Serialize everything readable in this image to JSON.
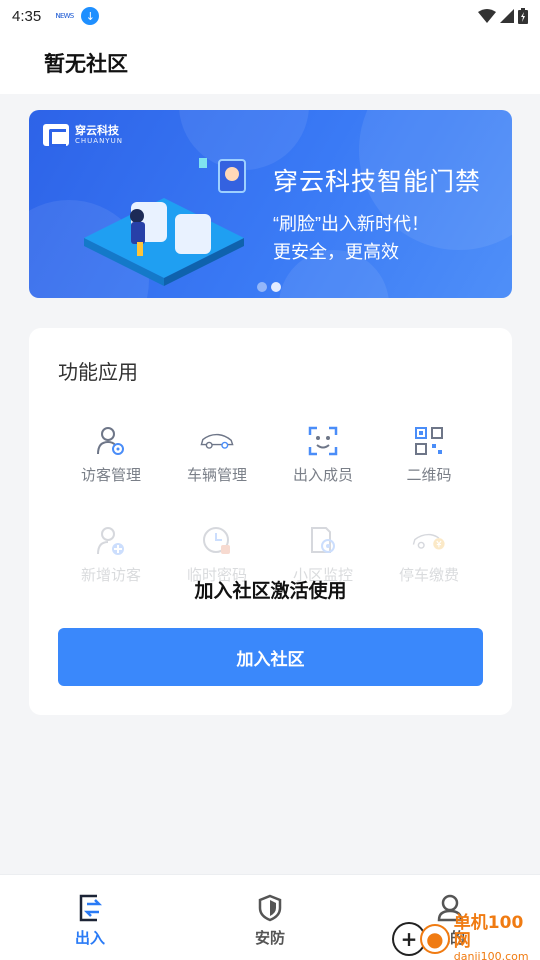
{
  "status_bar": {
    "time": "4:35",
    "small_icon": "ɴᴇᴡs",
    "download_icon": "download-icon",
    "wifi_icon": "wifi-icon",
    "signal_icon": "signal-icon",
    "battery_icon": "battery-icon"
  },
  "header": {
    "title": "暂无社区"
  },
  "banner": {
    "brand_cn": "穿云科技",
    "brand_en": "CHUANYUN",
    "title": "穿云科技智能门禁",
    "line1": "“刷脸”出入新时代！",
    "line2": "更安全，更高效",
    "pages": 2,
    "active_page": 2
  },
  "functions": {
    "title": "功能应用",
    "rows": [
      [
        {
          "label": "访客管理",
          "icon": "visitor-manage-icon"
        },
        {
          "label": "车辆管理",
          "icon": "car-icon"
        },
        {
          "label": "出入成员",
          "icon": "face-scan-icon"
        },
        {
          "label": "二维码",
          "icon": "qr-code-icon"
        }
      ],
      [
        {
          "label": "新增访客",
          "icon": "add-visitor-icon"
        },
        {
          "label": "临时密码",
          "icon": "clock-icon"
        },
        {
          "label": "小区监控",
          "icon": "monitor-icon"
        },
        {
          "label": "停车缴费",
          "icon": "parking-fee-icon"
        }
      ]
    ],
    "overlay_text": "加入社区激活使用",
    "join_button": "加入社区"
  },
  "bottom_nav": [
    {
      "label": "出入",
      "icon": "entry-icon",
      "active": true
    },
    {
      "label": "安防",
      "icon": "shield-icon",
      "active": false
    },
    {
      "label": "我的",
      "icon": "profile-icon",
      "active": false
    }
  ],
  "watermark": {
    "cn": "单机100网",
    "url": "danji100.com"
  },
  "colors": {
    "accent": "#3a88fb",
    "nav_active": "#2a7bf6",
    "banner": "#2d63e8",
    "page_bg": "#f4f5f7"
  }
}
